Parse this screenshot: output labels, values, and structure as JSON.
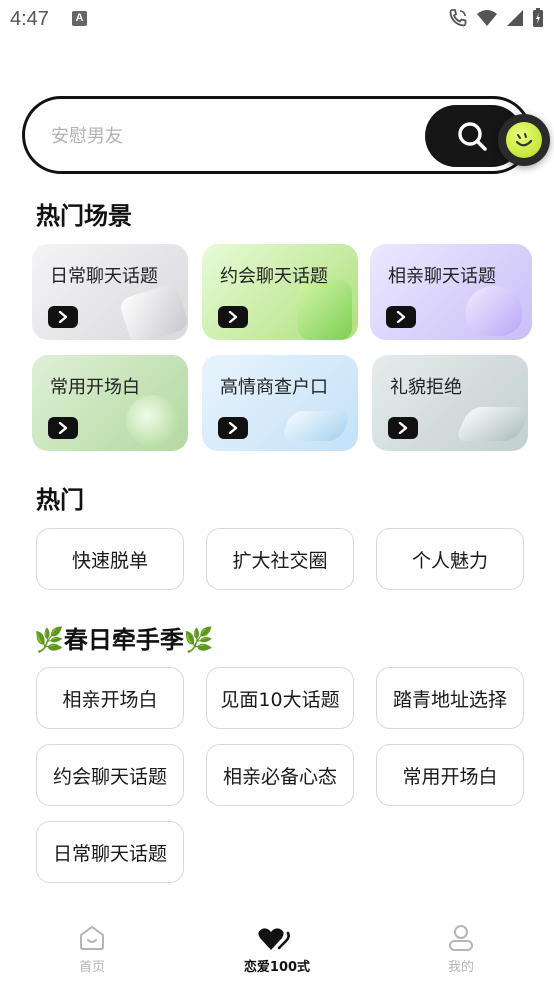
{
  "status_bar": {
    "time": "4:47",
    "notification_glyph": "A"
  },
  "search": {
    "placeholder": "安慰男友"
  },
  "scenes": {
    "title": "热门场景",
    "cards": [
      {
        "label": "日常聊天话题",
        "bg": "#ececef"
      },
      {
        "label": "约会聊天话题",
        "bg": "#c9eda8"
      },
      {
        "label": "相亲聊天话题",
        "bg": "#ddd6fb"
      },
      {
        "label": "常用开场白",
        "bg": "#c6e3b9"
      },
      {
        "label": "高情商查户口",
        "bg": "#d6ebfb"
      },
      {
        "label": "礼貌拒绝",
        "bg": "#d5dfdf"
      }
    ]
  },
  "hot": {
    "title": "热门",
    "items": [
      "快速脱单",
      "扩大社交圈",
      "个人魅力"
    ]
  },
  "spring": {
    "title": "🌿春日牵手季🌿",
    "items": [
      "相亲开场白",
      "见面10大话题",
      "踏青地址选择",
      "约会聊天话题",
      "相亲必备心态",
      "常用开场白",
      "日常聊天话题"
    ]
  },
  "nav": {
    "home": "首页",
    "love100": "恋爱100式",
    "mine": "我的",
    "active": "love100"
  }
}
